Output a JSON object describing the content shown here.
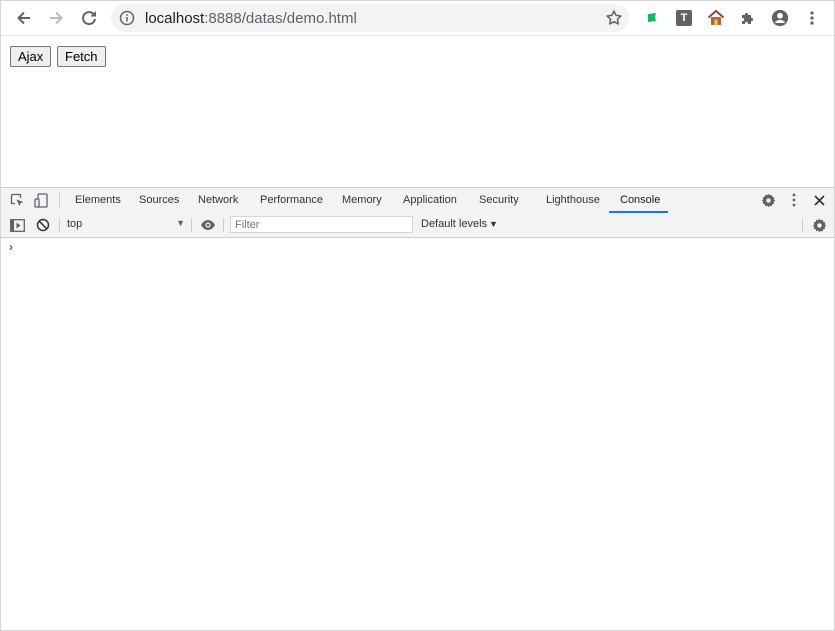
{
  "browser": {
    "url_host": "localhost",
    "url_rest": ":8888/datas/demo.html",
    "back_icon": "arrow-left-icon",
    "forward_icon": "arrow-right-icon",
    "reload_icon": "reload-icon",
    "info_icon": "info-circle-icon",
    "bookmark_icon": "star-icon",
    "extensions": [
      {
        "name": "flag-extension-icon",
        "color": "#1db26b"
      },
      {
        "name": "t-extension-icon",
        "label": "T"
      },
      {
        "name": "house-extension-icon",
        "color": "#8a4b2f"
      },
      {
        "name": "puzzle-extensions-icon"
      },
      {
        "name": "profile-avatar-icon"
      },
      {
        "name": "kebab-menu-icon"
      }
    ]
  },
  "page": {
    "ajax_label": "Ajax",
    "fetch_label": "Fetch"
  },
  "devtools": {
    "tabs": [
      "Elements",
      "Sources",
      "Network",
      "Performance",
      "Memory",
      "Application",
      "Security",
      "Lighthouse",
      "Console"
    ],
    "active_tab": "Console",
    "accent_color": "#1a73e8",
    "console": {
      "context": "top",
      "filter_placeholder": "Filter",
      "levels_label": "Default levels",
      "prompt_symbol": "›"
    }
  }
}
